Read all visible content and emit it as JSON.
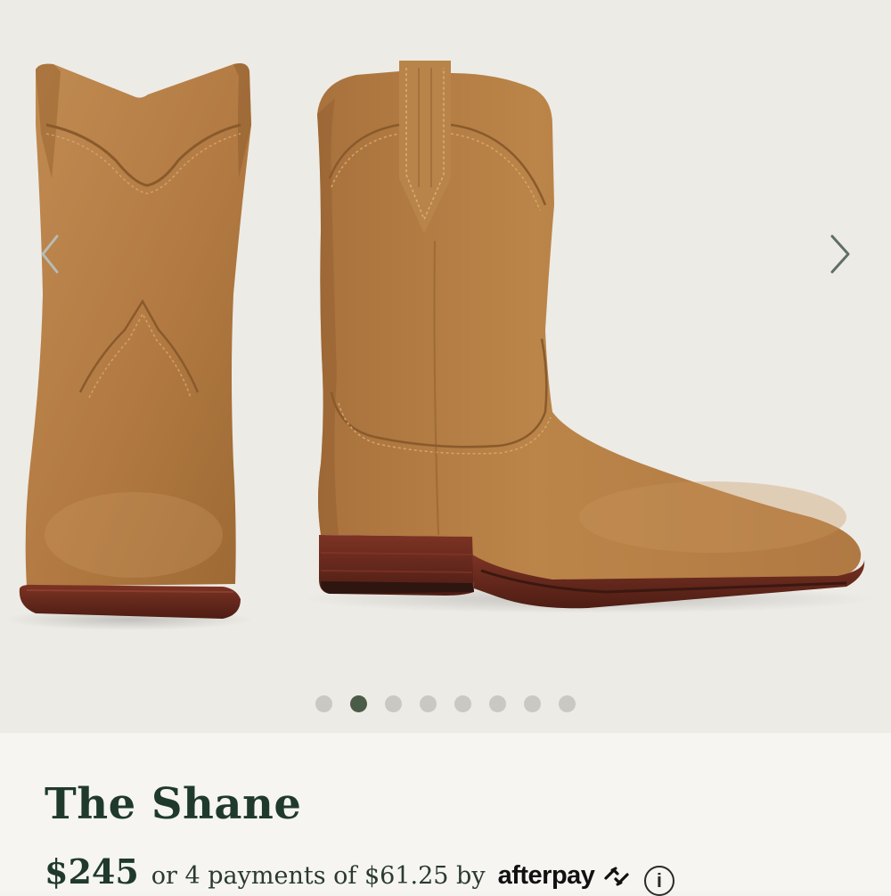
{
  "gallery": {
    "image_alt": "The Shane suede western boots, front and side view",
    "slide_count": 8,
    "active_slide": 2,
    "prev_icon": "chevron-left-icon",
    "next_icon": "chevron-right-icon"
  },
  "product": {
    "title": "The Shane",
    "price": "$245",
    "installments_text": "or 4 payments of $61.25 by",
    "afterpay_label": "afterpay",
    "info_symbol": "i"
  },
  "colors": {
    "title": "#1f3a2d",
    "active_dot": "#4a5c47",
    "inactive_dot": "#c9c8c3",
    "suede": "#b47e46",
    "sole": "#6e2a1e"
  }
}
